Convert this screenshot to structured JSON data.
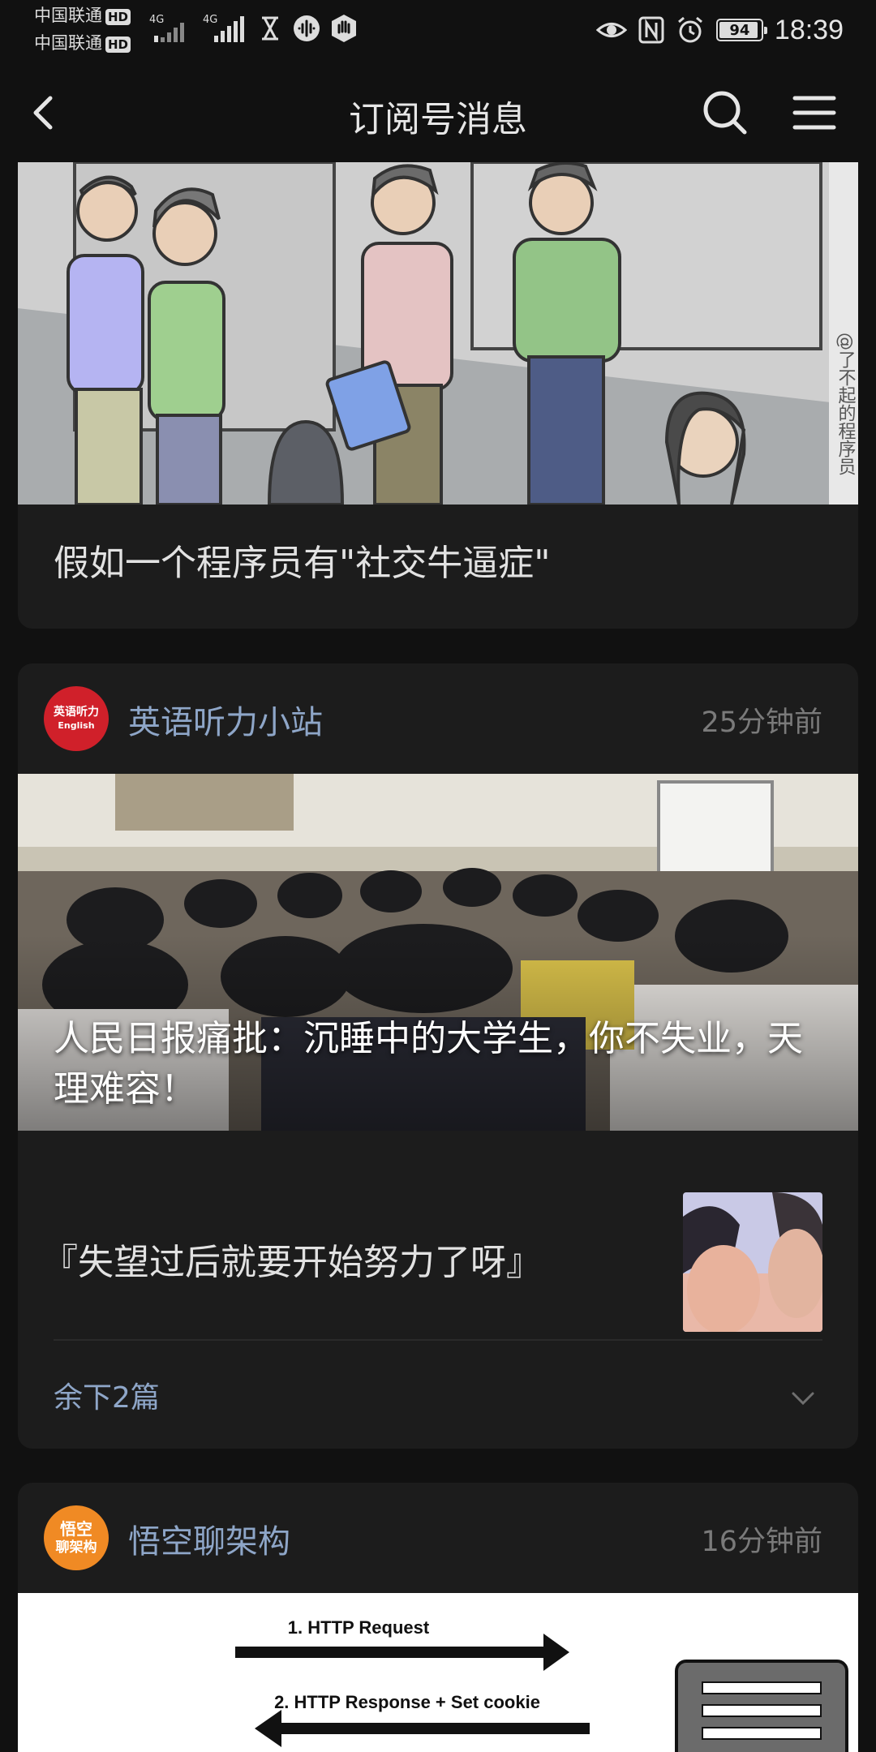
{
  "status_bar": {
    "carrier1": "中国联通",
    "carrier2": "中国联通",
    "hd_label": "HD",
    "net1": "4G",
    "net2": "4G",
    "battery": "94",
    "battery_level": 0.94,
    "time": "18:39"
  },
  "nav": {
    "title": "订阅号消息",
    "back_icon": "chevron-left-icon",
    "search_icon": "search-icon",
    "menu_icon": "hamburger-icon"
  },
  "card1": {
    "title": "假如一个程序员有\"社交牛逼症\"",
    "watermark": "@了不起的程序员"
  },
  "card2": {
    "account": "英语听力小站",
    "avatar_line1": "英语听力",
    "avatar_line2": "English",
    "time": "25分钟前",
    "hero_title": "人民日报痛批：沉睡中的大学生，你不失业，天理难容！",
    "sub_title": "『失望过后就要开始努力了呀』",
    "remaining": "余下2篇",
    "colors": {
      "avatar_bg": "#d0202a"
    }
  },
  "card3": {
    "account": "悟空聊架构",
    "avatar_line1": "悟空",
    "avatar_line2": "聊架构",
    "time": "16分钟前",
    "diagram_label1": "1. HTTP Request",
    "diagram_label2": "2. HTTP Response + Set cookie",
    "colors": {
      "avatar_bg": "#f08a24"
    }
  }
}
